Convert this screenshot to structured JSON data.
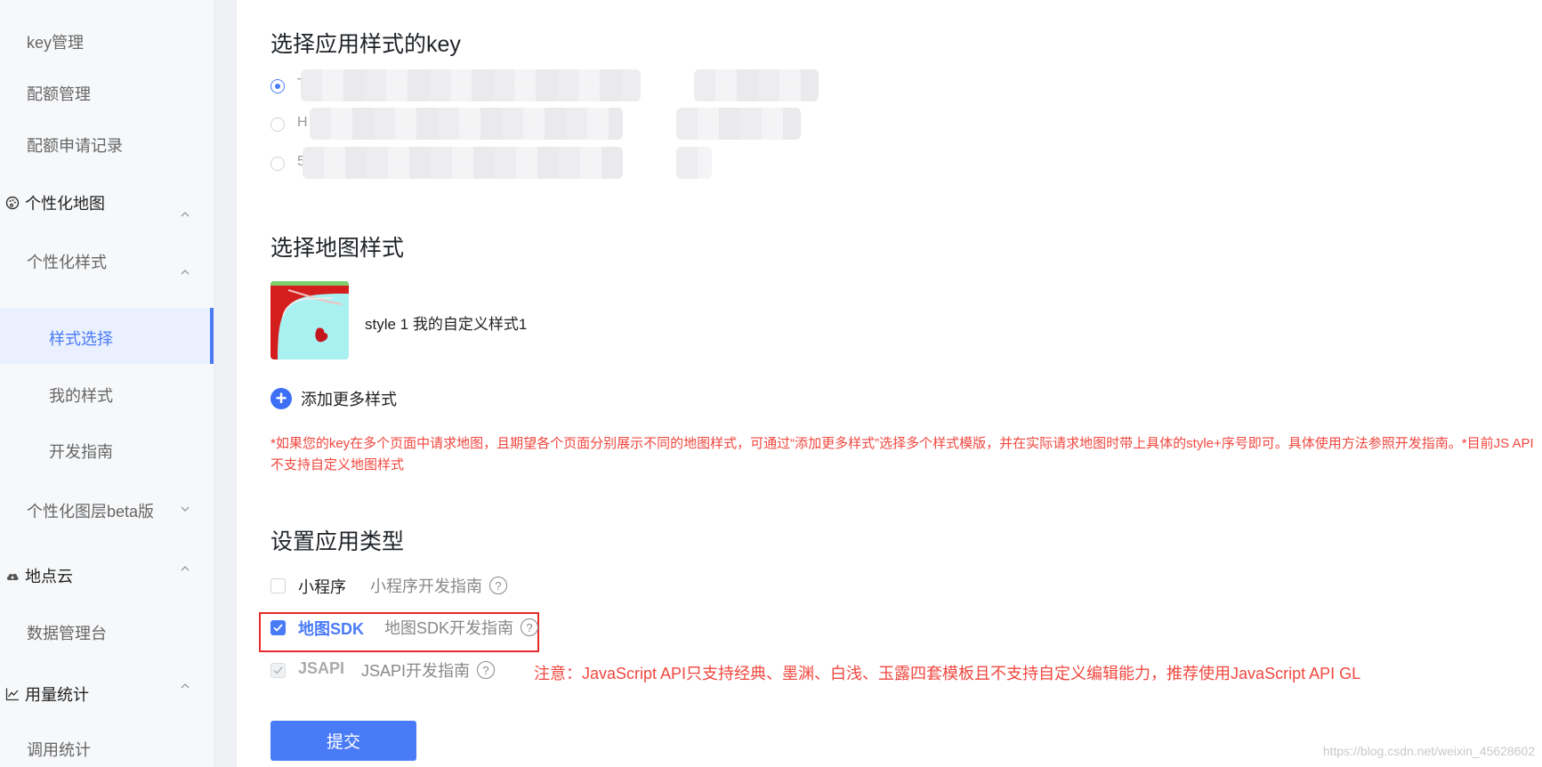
{
  "sidebar": {
    "items": [
      {
        "label": "key管理"
      },
      {
        "label": "配额管理"
      },
      {
        "label": "配额申请记录"
      },
      {
        "label": "个性化地图",
        "icon": "palette-icon"
      },
      {
        "label": "个性化样式"
      },
      {
        "label": "样式选择"
      },
      {
        "label": "我的样式"
      },
      {
        "label": "开发指南"
      },
      {
        "label": "个性化图层beta版"
      },
      {
        "label": "地点云",
        "icon": "cloud-icon"
      },
      {
        "label": "数据管理台"
      },
      {
        "label": "用量统计",
        "icon": "line-chart-icon"
      },
      {
        "label": "调用统计"
      }
    ]
  },
  "main": {
    "key_section_title": "选择应用样式的key",
    "key_options": [
      {
        "label": "T",
        "selected": true
      },
      {
        "label": "H",
        "selected": false
      },
      {
        "label": "5",
        "selected": false
      }
    ],
    "style_section_title": "选择地图样式",
    "selected_style_label": "style 1 我的自定义样式1",
    "add_style_label": "添加更多样式",
    "style_note": "*如果您的key在多个页面中请求地图，且期望各个页面分别展示不同的地图样式，可通过“添加更多样式”选择多个样式模版，并在实际请求地图时带上具体的style+序号即可。具体使用方法参照开发指南。*目前JS API不支持自定义地图样式",
    "app_type_title": "设置应用类型",
    "app_types": [
      {
        "label": "小程序",
        "guide": "小程序开发指南",
        "checked": false,
        "disabled": false
      },
      {
        "label": "地图SDK",
        "guide": "地图SDK开发指南",
        "checked": true,
        "disabled": false
      },
      {
        "label": "JSAPI",
        "guide": "JSAPI开发指南",
        "checked": true,
        "disabled": true
      }
    ],
    "jsapi_warning": "注意：JavaScript API只支持经典、墨渊、白浅、玉露四套模板且不支持自定义编辑能力，推荐使用JavaScript API GL",
    "submit_label": "提交",
    "help_icon_glyph": "?"
  },
  "watermark": "https://blog.csdn.net/weixin_45628602",
  "colors": {
    "accent": "#4a7bf7",
    "warning": "#f0473f",
    "highlight_box": "#e52b2b"
  }
}
